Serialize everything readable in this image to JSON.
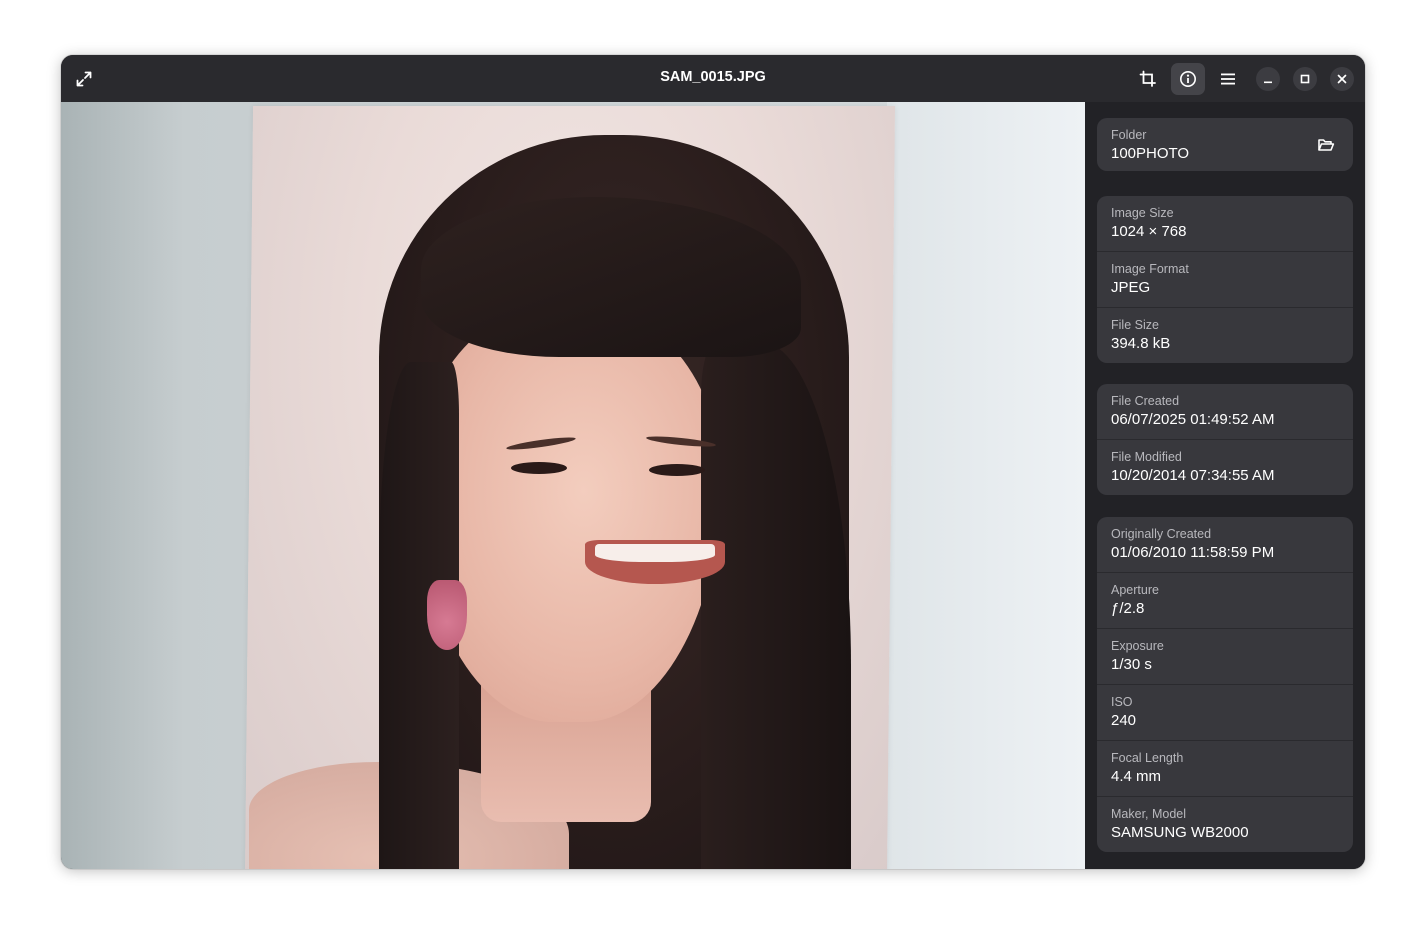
{
  "window": {
    "title": "SAM_0015.JPG"
  },
  "headerbar": {
    "fullscreen_icon": "expand-arrows-icon",
    "crop_icon": "crop-icon",
    "info_icon": "info-icon",
    "menu_icon": "hamburger-menu-icon",
    "minimize_icon": "minimize-icon",
    "maximize_icon": "maximize-icon",
    "close_icon": "close-icon"
  },
  "properties": {
    "folder": {
      "label": "Folder",
      "value": "100PHOTO",
      "open_icon": "folder-open-icon"
    },
    "image": [
      {
        "label": "Image Size",
        "value": "1024 × 768"
      },
      {
        "label": "Image Format",
        "value": "JPEG"
      },
      {
        "label": "File Size",
        "value": "394.8 kB"
      }
    ],
    "dates": [
      {
        "label": "File Created",
        "value": "06/07/2025 01:49:52 AM"
      },
      {
        "label": "File Modified",
        "value": "10/20/2014 07:34:55 AM"
      }
    ],
    "exif": [
      {
        "label": "Originally Created",
        "value": "01/06/2010 11:58:59 PM"
      },
      {
        "label": "Aperture",
        "value": "ƒ/2.8"
      },
      {
        "label": "Exposure",
        "value": "1/30 s"
      },
      {
        "label": "ISO",
        "value": "240"
      },
      {
        "label": "Focal Length",
        "value": "4.4 mm"
      },
      {
        "label": "Maker, Model",
        "value": "SAMSUNG WB2000"
      }
    ]
  },
  "colors": {
    "headerbar": "#2a2a2e",
    "sidebar": "#222226",
    "card": "#38383d",
    "label": "#b8b8bd",
    "value": "#ffffff"
  }
}
